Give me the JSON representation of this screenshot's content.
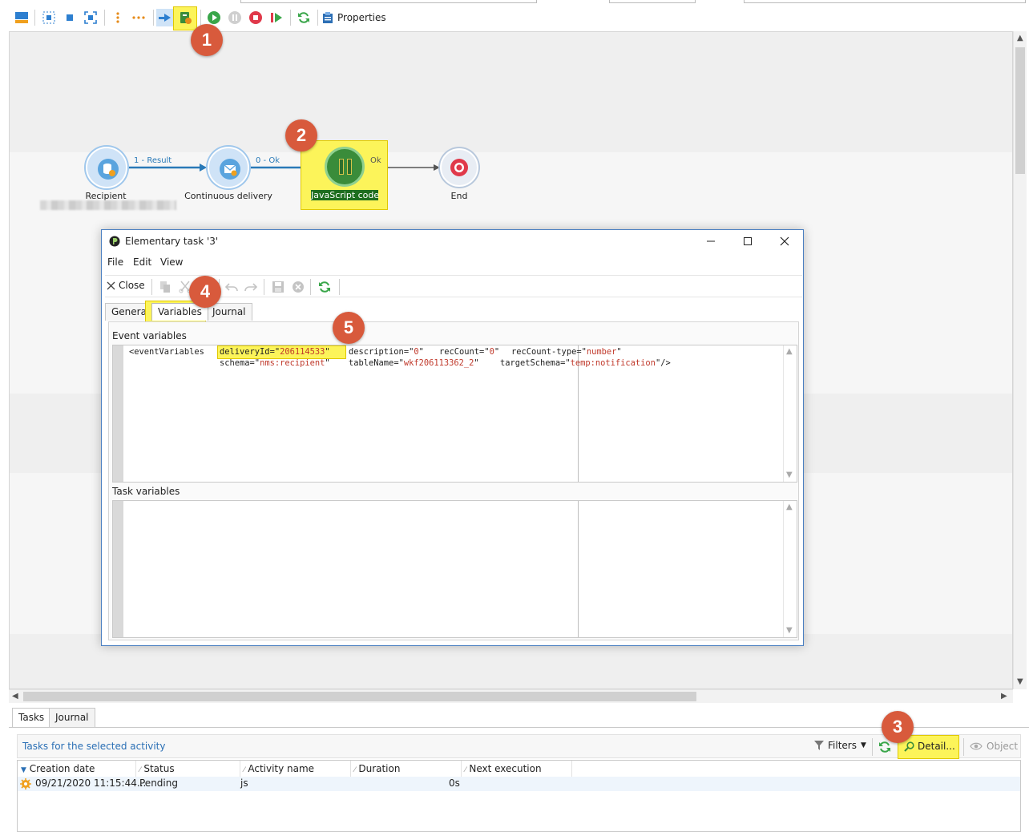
{
  "toolbar": {
    "properties_label": "Properties"
  },
  "workflow": {
    "nodes": [
      {
        "id": "recipient",
        "label": "Recipient"
      },
      {
        "id": "delivery",
        "label": "Continuous delivery"
      },
      {
        "id": "jscode",
        "label": "JavaScript code"
      },
      {
        "id": "end",
        "label": "End"
      }
    ],
    "transitions": [
      "1 - Result",
      "0 - Ok",
      "Ok"
    ]
  },
  "badges": [
    "1",
    "2",
    "3",
    "4",
    "5"
  ],
  "dialog": {
    "title": "Elementary task '3'",
    "menu": [
      "File",
      "Edit",
      "View"
    ],
    "close_label": "Close",
    "tabs": [
      "General",
      "Variables",
      "Journal"
    ],
    "active_tab": "Variables",
    "event_variables_label": "Event variables",
    "task_variables_label": "Task variables",
    "xml": {
      "open": "<eventVariables",
      "attrs_line1": [
        {
          "name": "deliveryId",
          "value": "206114533"
        },
        {
          "name": "description",
          "value": "0"
        },
        {
          "name": "recCount",
          "value": "0"
        },
        {
          "name": "recCount-type",
          "value": "number"
        }
      ],
      "attrs_line2": [
        {
          "name": "schema",
          "value": "nms:recipient"
        },
        {
          "name": "tableName",
          "value": "wkf206113362_2"
        },
        {
          "name": "targetSchema",
          "value": "temp:notification"
        }
      ],
      "close": "/>"
    }
  },
  "bottom": {
    "tabs": [
      "Tasks",
      "Journal"
    ],
    "tasks_title": "Tasks for the selected activity",
    "filters_label": "Filters",
    "detail_label": "Detail...",
    "object_label": "Object",
    "columns": [
      "Creation date",
      "Status",
      "Activity name",
      "Duration",
      "Next execution"
    ],
    "rows": [
      {
        "creation_date": "09/21/2020 11:15:44...",
        "status": "Pending",
        "activity_name": "js",
        "duration": "0s",
        "next_execution": ""
      }
    ]
  },
  "colors": {
    "badge": "#d85a3c",
    "highlight": "#fcf45a",
    "node_blue": "#5aa4de",
    "node_green": "#3a8c3a",
    "node_red": "#e0394a",
    "link_blue": "#2a7ab8"
  }
}
